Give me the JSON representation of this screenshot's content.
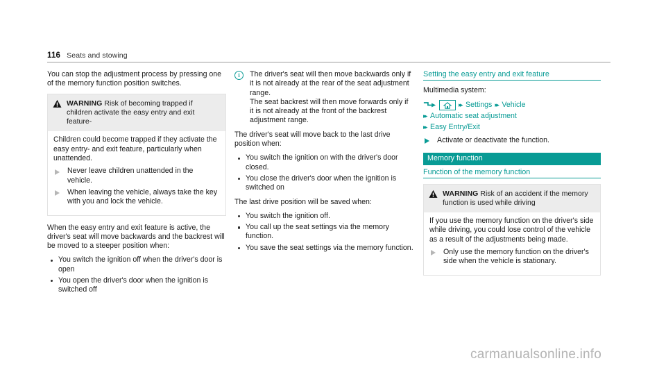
{
  "header": {
    "page_number": "116",
    "section_title": "Seats and stowing"
  },
  "column1": {
    "intro": "You can stop the adjustment process by pressing one of the memory function position switches.",
    "warning": {
      "icon": "warning-triangle-icon",
      "label": "WARNING",
      "headline": "Risk of becoming trapped if children activate the easy entry and exit feature-",
      "body": "Children could become trapped if they activate the easy entry- and exit feature, particularly when unattended.",
      "actions": [
        "Never leave children unattended in the vehicle.",
        "When leaving the vehicle, always take the key with you and lock the vehicle."
      ]
    },
    "active_intro": "When the easy entry and exit feature is active, the driver's seat will move backwards and the backrest will be moved to a steeper position when:",
    "active_conditions": [
      "You switch the ignition off when the driver's door is open",
      "You open the driver's door when the ignition is switched off"
    ]
  },
  "column2": {
    "note": {
      "icon": "info-circle-icon",
      "text": "The driver's seat will then move backwards only if it is not already at the rear of the seat adjustment range.\nThe seat backrest will then move forwards only if it is not already at the front of the backrest adjustment range."
    },
    "note_line1": "The driver's seat will then move backwards only if it is not already at the rear of the seat adjustment range.",
    "note_line2": "The seat backrest will then move forwards only if it is not already at the front of the backrest adjustment range.",
    "last_drive_intro": "The driver's seat will move back to the last drive position when:",
    "last_drive_conditions": [
      "You switch the ignition on with the driver's door closed.",
      "You close the driver's door when the ignition is switched on"
    ],
    "saved_intro": "The last drive position will be saved when:",
    "saved_conditions": [
      "You switch the ignition off.",
      "You call up the seat settings via the memory function.",
      "You save the seat settings via the memory function."
    ]
  },
  "column3": {
    "subheading": "Setting the easy entry and exit feature",
    "multimedia_label": "Multimedia system:",
    "nav_path": {
      "enter_icon": "enter-arrow-icon",
      "home_icon": "home-icon",
      "steps": [
        "Settings",
        "Vehicle",
        "Automatic seat adjustment",
        "Easy Entry/Exit"
      ]
    },
    "action": "Activate or deactivate the function.",
    "banner": "Memory function",
    "section_subheading": "Function of the memory function",
    "warning": {
      "icon": "warning-triangle-icon",
      "label": "WARNING",
      "headline": "Risk of an accident if the memory function is used while driving",
      "body": "If you use the memory function on the driver's side while driving, you could lose control of the vehicle as a result of the adjustments being made.",
      "actions": [
        "Only use the memory function on the driver's side when the vehicle is stationary."
      ]
    }
  },
  "watermark": "carmanualsonline.info",
  "colors": {
    "teal": "#089b95",
    "warning_header_bg": "#ececec",
    "text": "#1a1a1a",
    "watermark": "#b4b4b4"
  }
}
